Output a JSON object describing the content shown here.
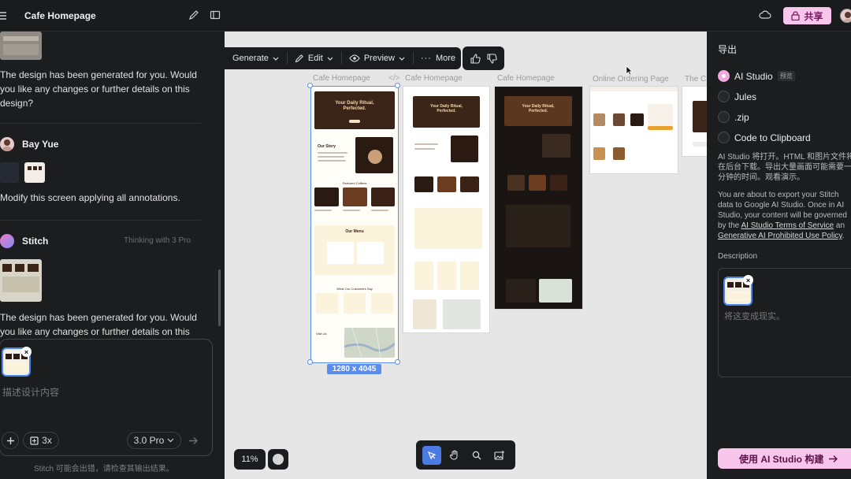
{
  "topbar": {
    "title": "Cafe Homepage",
    "share_label": "共享"
  },
  "chat": {
    "generated_msg_1": "The design has been generated for you. Would you like any changes or further details on this design?",
    "user_name": "Bay Yue",
    "user_msg": "Modify this screen applying all annotations.",
    "bot_name": "Stitch",
    "thinking_label": "Thinking with 3 Pro",
    "generated_msg_2": "The design has been generated for you. Would you like any changes or further details on this",
    "compose_placeholder": "描述设计内容",
    "count_label": "3x",
    "model_label": "3.0 Pro",
    "footer_note": "Stitch 可能会出错，请检查其输出结果。"
  },
  "canvas": {
    "toolbar": {
      "generate": "Generate",
      "edit": "Edit",
      "preview": "Preview",
      "more": "More"
    },
    "frames": [
      {
        "label": "Cafe Homepage"
      },
      {
        "label": "Cafe Homepage"
      },
      {
        "label": "Cafe Homepage"
      },
      {
        "label": "Online Ordering Page"
      },
      {
        "label": "The C"
      }
    ],
    "code_tag": "</>",
    "selection_size": "1280 x 4045",
    "zoom": "11%",
    "hero_text": "Your Daily Ritual, Perfected.",
    "story_title": "Our Story",
    "featured_title": "Featured Coffees",
    "menu_title": "Our Menu",
    "reviews_title": "What Our Customers Say",
    "visit_title": "Visit Us"
  },
  "export": {
    "title": "导出",
    "options": [
      {
        "label": "AI Studio",
        "tag": "预览",
        "selected": true
      },
      {
        "label": "Jules",
        "selected": false
      },
      {
        "label": ".zip",
        "selected": false
      },
      {
        "label": "Code to Clipboard",
        "selected": false
      }
    ],
    "info_cn_lines": [
      "AI Studio 将打开。HTML 和图片文件将",
      "在后台下载。导出大量画面可能需要一",
      "分钟的时间。观看演示。"
    ],
    "info_en_1": "You are about to export your Stitch",
    "info_en_2": "data to Google AI Studio. Once in AI",
    "info_en_3": "Studio, your content will be governed",
    "info_en_4_pre": "by the ",
    "terms_link": "AI Studio Terms of Service",
    "info_en_4_post": " an",
    "policy_link": "Generative AI Prohibited Use Policy",
    "policy_post": ".",
    "description_label": "Description",
    "description_placeholder": "将这变成现实。",
    "build_label": "使用 AI Studio 构建"
  },
  "colors": {
    "accent_pink": "#f8c6ec",
    "selection_blue": "#5b8def",
    "coffee_dark": "#3b2418",
    "coffee_cream": "#fbf3dc"
  }
}
